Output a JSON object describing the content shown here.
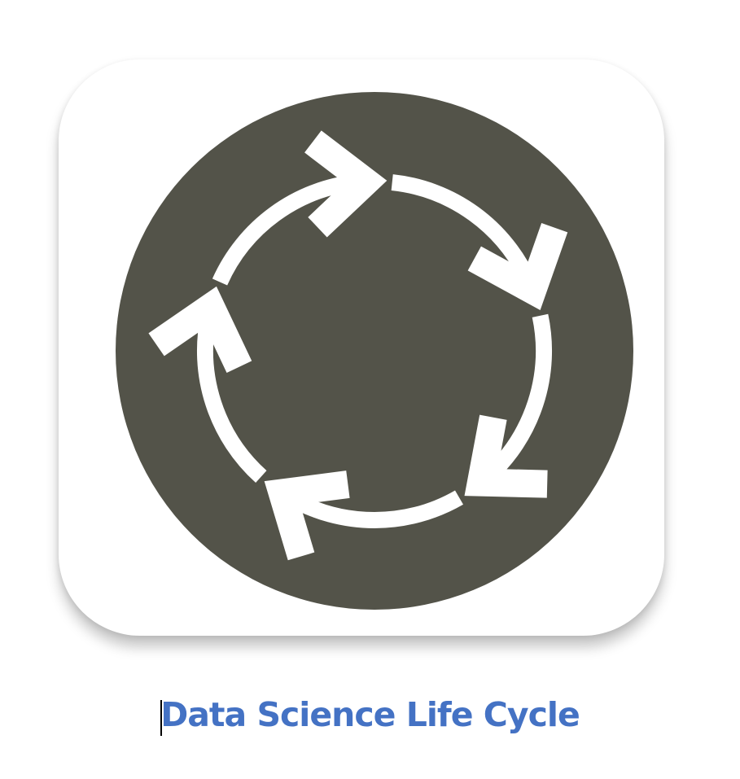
{
  "caption": {
    "text": "Data Science Life Cycle",
    "color": "#4472c4"
  },
  "icon": {
    "name": "cycle-arrows-icon",
    "circle_color": "#535349",
    "arrow_color": "#ffffff",
    "arrow_count": 5
  }
}
